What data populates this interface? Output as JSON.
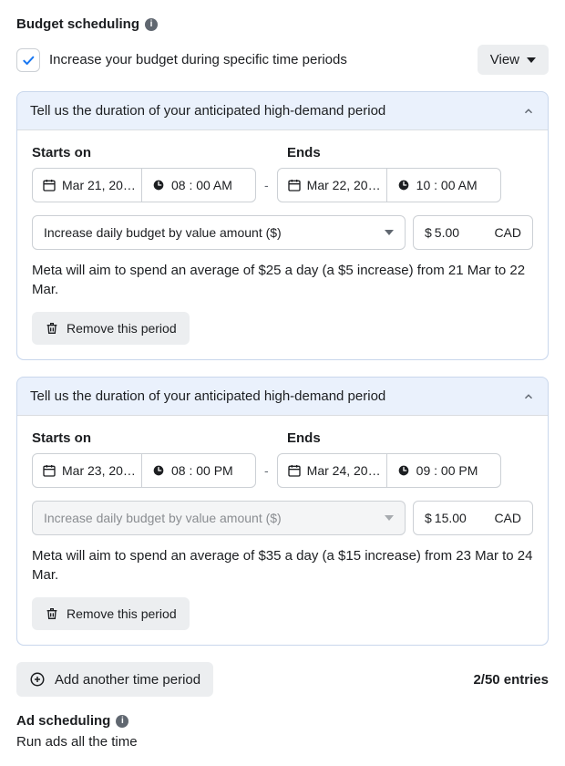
{
  "budget_scheduling": {
    "title": "Budget scheduling",
    "checkbox_label": "Increase your budget during specific time periods",
    "view_label": "View"
  },
  "periods": [
    {
      "header": "Tell us the duration of your anticipated high-demand period",
      "starts_label": "Starts on",
      "ends_label": "Ends",
      "start_date": "Mar 21, 20…",
      "start_time": "08 : 00 AM",
      "end_date": "Mar 22, 20…",
      "end_time": "10 : 00 AM",
      "increase_type": "Increase daily budget by value amount ($)",
      "increase_disabled": false,
      "currency_symbol": "$",
      "amount": "5.00",
      "currency": "CAD",
      "explain": "Meta will aim to spend an average of $25 a day (a $5 increase) from 21 Mar to 22 Mar.",
      "remove_label": "Remove this period"
    },
    {
      "header": "Tell us the duration of your anticipated high-demand period",
      "starts_label": "Starts on",
      "ends_label": "Ends",
      "start_date": "Mar 23, 20…",
      "start_time": "08 : 00 PM",
      "end_date": "Mar 24, 20…",
      "end_time": "09 : 00 PM",
      "increase_type": "Increase daily budget by value amount ($)",
      "increase_disabled": true,
      "currency_symbol": "$",
      "amount": "15.00",
      "currency": "CAD",
      "explain": "Meta will aim to spend an average of $35 a day (a $15 increase) from 23 Mar to 24 Mar.",
      "remove_label": "Remove this period"
    }
  ],
  "footer": {
    "add_label": "Add another time period",
    "entries": "2/50 entries"
  },
  "ad_scheduling": {
    "title": "Ad scheduling",
    "subtitle": "Run ads all the time"
  }
}
